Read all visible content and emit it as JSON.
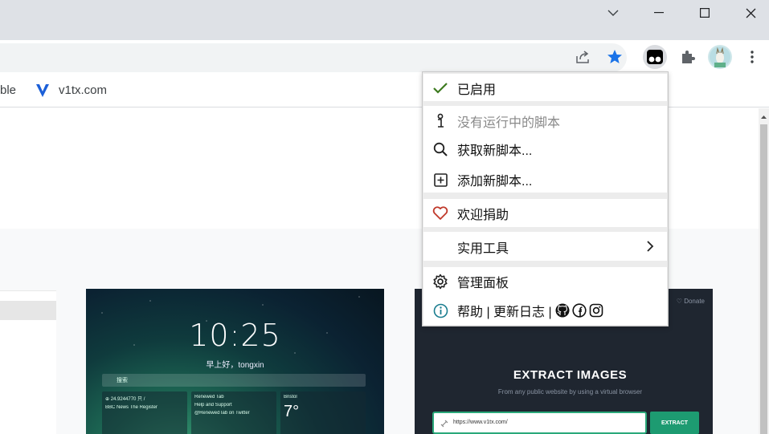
{
  "bookmarks": {
    "partial_label": "ble",
    "site_label": "v1tx.com"
  },
  "newtab_card": {
    "time": "10:25",
    "greeting": "早上好，tongxin",
    "search_placeholder": "搜索",
    "panel1_line1": "⊕ 24.9244770 只 /",
    "panel1_line2": "BBC News   The Register",
    "panel2_line1": "Renewed Tab",
    "panel2_line2": "Help and Support",
    "panel2_line3": "@RenewedTab on Twitter",
    "panel3_city": "Bristol",
    "panel3_temp": "7°"
  },
  "extract_card": {
    "donate": "Donate",
    "title": "EXTRACT IMAGES",
    "subtitle": "From any public website by using a virtual browser",
    "url_value": "https://www.v1tx.com/",
    "button": "EXTRACT"
  },
  "menu": {
    "enabled": "已启用",
    "no_scripts": "没有运行中的脚本",
    "get_scripts": "获取新脚本...",
    "add_script": "添加新脚本...",
    "donate": "欢迎捐助",
    "utilities": "实用工具",
    "dashboard": "管理面板",
    "help": "帮助 | 更新日志 |"
  },
  "colors": {
    "check": "#3d7a1f",
    "heart": "#c0392b",
    "star": "#1a73e8",
    "info": "#1a7d8f"
  }
}
